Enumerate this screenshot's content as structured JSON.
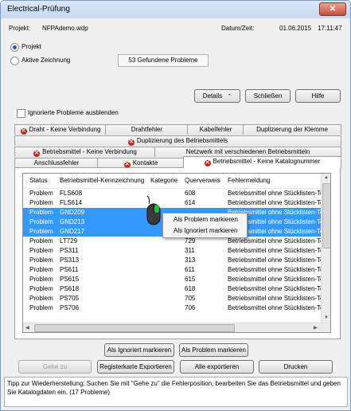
{
  "window": {
    "title": "Electrical-Prüfung",
    "close_label": "✕"
  },
  "header": {
    "project_label": "Projekt:",
    "project_value": "NFPAdemo.wdp",
    "datetime_label": "Datum/Zeit:",
    "date_value": "01.06.2015",
    "time_value": "17:11:47"
  },
  "scope": {
    "option_project": "Projekt",
    "option_drawing": "Aktive Zeichnung",
    "selected": "Projekt",
    "problems_found": "53 Gefundene Probleme"
  },
  "top_buttons": {
    "details": "Details",
    "close": "Schließen",
    "help": "Hilfe"
  },
  "hide_ignored": {
    "label": "Ignorierte Probleme ausblenden",
    "checked": false
  },
  "tabs": {
    "row1": [
      "Draht - Keine Verbindung",
      "Drahtfehler",
      "Kabelfehler",
      "Duplizierung der Klemme"
    ],
    "row2": [
      "Duplizierung des Betriebsmittels"
    ],
    "row3": [
      "Betriebsmittel - Keine Verbindung",
      "Netzwerk mit verschiedenen Betriebsmitteln"
    ],
    "row4": [
      "Anschlussfehler",
      "Kontakte",
      "Betriebsmittel - Keine Katalognummer"
    ]
  },
  "table": {
    "columns": [
      "Status",
      "Betriebsmittel-Kennzeichnung",
      "Kategorie",
      "Querverweis",
      "Fehlermeldung"
    ],
    "rows": [
      {
        "status": "Problem",
        "tag": "FLS608",
        "category": "",
        "ref": "608",
        "message": "Betriebsmittel ohne Stücklisten-Te",
        "selected": false
      },
      {
        "status": "Problem",
        "tag": "FLS614",
        "category": "",
        "ref": "614",
        "message": "Betriebsmittel ohne Stücklisten-Te",
        "selected": false
      },
      {
        "status": "Problem",
        "tag": "GND209",
        "category": "",
        "ref": "",
        "message": "Betriebsmittel ohne Stücklisten-Te",
        "selected": true
      },
      {
        "status": "Problem",
        "tag": "GND213",
        "category": "",
        "ref": "",
        "message": "Betriebsmittel ohne Stücklisten-Te",
        "selected": true
      },
      {
        "status": "Problem",
        "tag": "GND217",
        "category": "",
        "ref": "",
        "message": "Betriebsmittel ohne Stücklisten-Te",
        "selected": true
      },
      {
        "status": "Problem",
        "tag": "LT729",
        "category": "",
        "ref": "729",
        "message": "Betriebsmittel ohne Stücklisten-Te",
        "selected": false
      },
      {
        "status": "Problem",
        "tag": "PS311",
        "category": "",
        "ref": "311",
        "message": "Betriebsmittel ohne Stücklisten-Te",
        "selected": false
      },
      {
        "status": "Problem",
        "tag": "PS313",
        "category": "",
        "ref": "313",
        "message": "Betriebsmittel ohne Stücklisten-Te",
        "selected": false
      },
      {
        "status": "Problem",
        "tag": "PS611",
        "category": "",
        "ref": "611",
        "message": "Betriebsmittel ohne Stücklisten-Te",
        "selected": false
      },
      {
        "status": "Problem",
        "tag": "PS615",
        "category": "",
        "ref": "615",
        "message": "Betriebsmittel ohne Stücklisten-Te",
        "selected": false
      },
      {
        "status": "Problem",
        "tag": "PS618",
        "category": "",
        "ref": "618",
        "message": "Betriebsmittel ohne Stücklisten-Te",
        "selected": false
      },
      {
        "status": "Problem",
        "tag": "PS705",
        "category": "",
        "ref": "705",
        "message": "Betriebsmittel ohne Stücklisten-Te",
        "selected": false
      },
      {
        "status": "Problem",
        "tag": "PS706",
        "category": "",
        "ref": "706",
        "message": "Betriebsmittel ohne Stücklisten-Te",
        "selected": false
      }
    ]
  },
  "context_menu": {
    "mark_problem": "Als Problem markieren",
    "mark_ignored": "Als Ignoriert markieren"
  },
  "mark_buttons": {
    "ignored": "Als Ignoriert markieren",
    "problem": "Als Problem markieren"
  },
  "bottom_buttons": {
    "goto": "Gehe zu",
    "export_tab": "Registerkarte Exportieren",
    "export_all": "Alle exportieren",
    "print": "Drucken"
  },
  "status_text": "Tipp zur Wiederherstellung: Suchen Sie mit \"Gehe zu\" die Fehlerposition, bearbeiten Sie das Betriebsmittel und geben Sie Katalogdaten ein. (17 Probleme)",
  "colors": {
    "selection": "#3399ff",
    "error_icon": "#c8221b",
    "title_bar": "#c5d9f1"
  }
}
